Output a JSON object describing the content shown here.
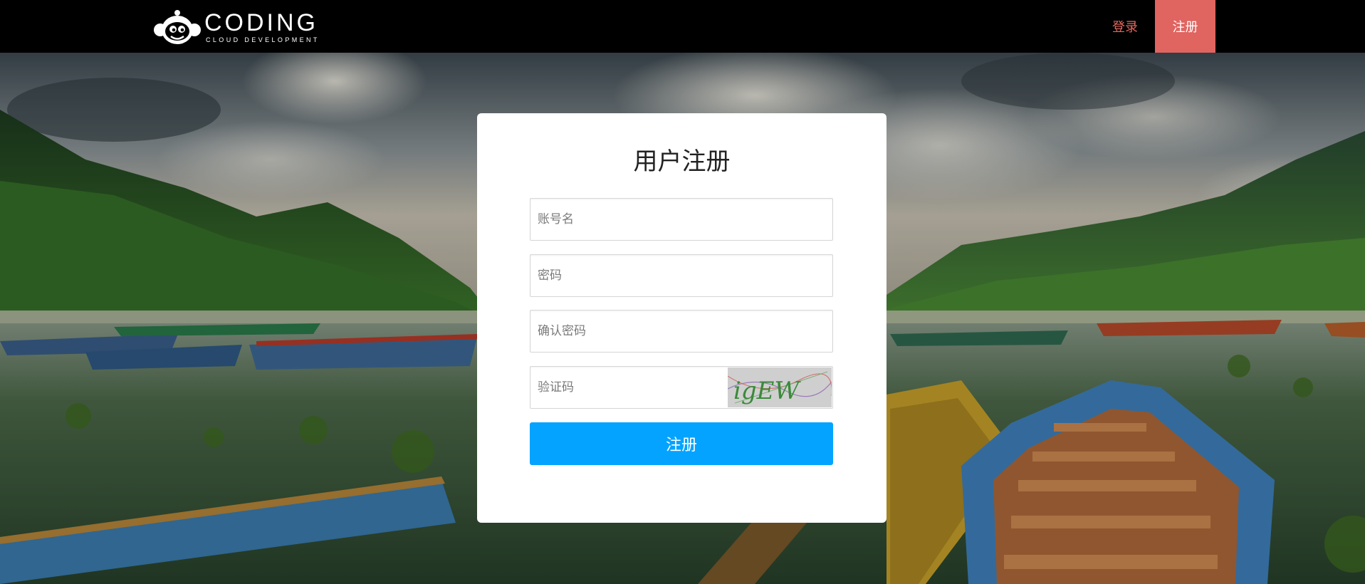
{
  "header": {
    "logo": {
      "word": "CODING",
      "tagline": "CLOUD DEVELOPMENT"
    },
    "nav": {
      "login_label": "登录",
      "register_label": "注册"
    }
  },
  "form": {
    "title": "用户注册",
    "fields": {
      "username_placeholder": "账号名",
      "password_placeholder": "密码",
      "confirm_password_placeholder": "确认密码",
      "captcha_placeholder": "验证码"
    },
    "captcha_text": "igEW",
    "submit_label": "注册"
  },
  "colors": {
    "header_bg": "#000000",
    "nav_login_text": "#e8685e",
    "nav_register_bg": "#e06460",
    "submit_bg": "#04a3ff",
    "card_bg": "#ffffff"
  }
}
